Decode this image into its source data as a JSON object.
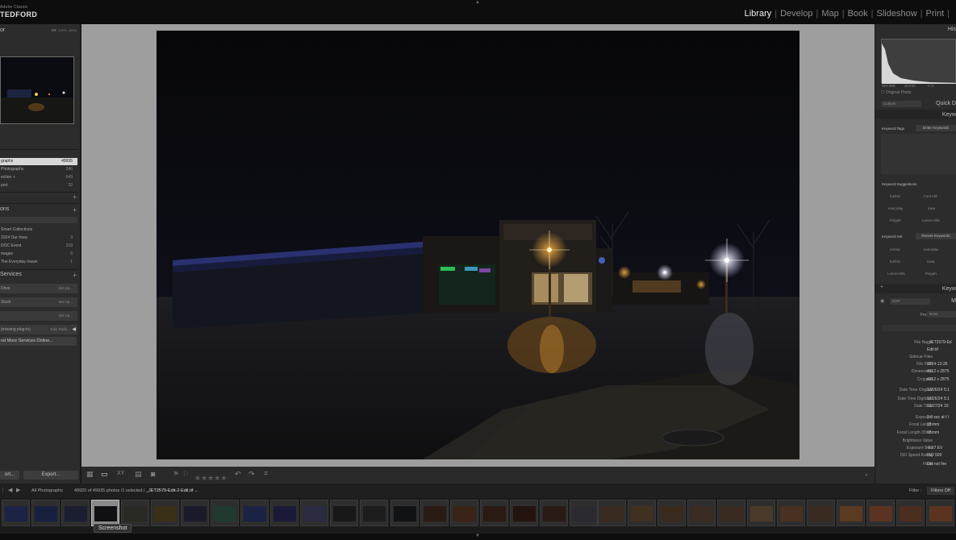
{
  "identity": {
    "line1": "Adobe Classic",
    "line2": "TEDFORD"
  },
  "modules": [
    "Library",
    "Develop",
    "Map",
    "Book",
    "Slideshow",
    "Print"
  ],
  "active_module": "Library",
  "left_panel": {
    "navigator_title": "or",
    "navigator_zoom": [
      "FIT",
      "100%",
      "400%"
    ],
    "catalog": [
      {
        "label": "graphs",
        "count": "49935",
        "selected": true
      },
      {
        "label": "Photographs",
        "count": "246"
      },
      {
        "label": "ection +",
        "count": "649"
      },
      {
        "label": "port",
        "count": "33"
      }
    ],
    "collections_title": "ons",
    "collections": [
      {
        "label": "Smart Collections",
        "count": ""
      },
      {
        "label": "2024 Our Iowa",
        "count": "3"
      },
      {
        "label": "DOC Event",
        "count": "239"
      },
      {
        "label": "mages",
        "count": "6"
      },
      {
        "label": "The Everyday Iowan",
        "count": "1"
      }
    ],
    "services_title": "Services",
    "services": [
      {
        "label": "Drive",
        "action": "Set Up..."
      },
      {
        "label": "Stock",
        "action": "Set Up..."
      },
      {
        "label": "",
        "action": "Set Up..."
      },
      {
        "label": "(missing plug-in)",
        "action": "Julie Tedfo..."
      }
    ],
    "find_more": "nd More Services Online...",
    "import_label": "ort...",
    "export_label": "Export..."
  },
  "right_panel": {
    "histogram_title": "His",
    "hist_meta": {
      "iso": "ISO 500",
      "focal": "15 mm",
      "aperture": "f / 2"
    },
    "original_photo": "Original Photo",
    "quick_develop": "Quick D",
    "saved_preset": "Custom",
    "keywording_title": "Keyw",
    "keyword_tags_label": "Keyword Tags",
    "enter_keywords": "Enter Keywords",
    "keyword_suggestions_label": "Keyword Suggestions",
    "suggestions": [
      "funfrol",
      "Font Hill",
      "everyday",
      "iowa",
      "Pisgah",
      "Loess Hills"
    ],
    "keyword_set_label": "Keyword Set",
    "keyword_set_value": "Recent Keywords",
    "recent": [
      "emma",
      "everyday",
      "funfrol",
      "iowa",
      "Loess Hills",
      "Pisgah"
    ],
    "keyword_list_title": "Keyw",
    "metadata_preset_label": "EXIF",
    "metadata_title": "M",
    "preset_label": "Preset",
    "preset_value": "None",
    "metadata": [
      {
        "label": "File Name",
        "value": "_JET2579-Ed"
      },
      {
        "label": "",
        "value": "Edit.tif"
      },
      {
        "label": "Sidecar Files",
        "value": ""
      },
      {
        "label": "File Path",
        "value": "2024-12-26"
      },
      {
        "label": "Dimensions",
        "value": "4312 x 2875"
      },
      {
        "label": "Cropped",
        "value": "4312 x 2875"
      },
      {
        "label": "Date Time Original",
        "value": "12/26/24 5:1"
      },
      {
        "label": "Date Time Digitized",
        "value": "12/26/24 5:1"
      },
      {
        "label": "Date Time",
        "value": "12/27/24 10:"
      },
      {
        "label": "Exposure",
        "value": "2.0 sec at f /"
      },
      {
        "label": "Focal Length",
        "value": "15 mm"
      },
      {
        "label": "Focal Length 35mm",
        "value": "15 mm"
      },
      {
        "label": "Brightness Value",
        "value": ""
      },
      {
        "label": "Exposure Bias",
        "value": "-0.67 EV"
      },
      {
        "label": "ISO Speed Rating",
        "value": "ISO 500"
      },
      {
        "label": "Flash",
        "value": "Did not fire"
      }
    ]
  },
  "filmstrip_bar": {
    "source": "All Photographs",
    "status": "49920 of 49935 photos /1 selected /",
    "filename": "_JET2579-Edit-2-Edit.tif",
    "filter_label": "Filter :",
    "filter_value": "Filters Off"
  },
  "tooltip": "Screenshot",
  "colors": {
    "accent": "#f0f0f0",
    "panel": "#2c2c2c",
    "workspace": "#9e9e9e"
  }
}
